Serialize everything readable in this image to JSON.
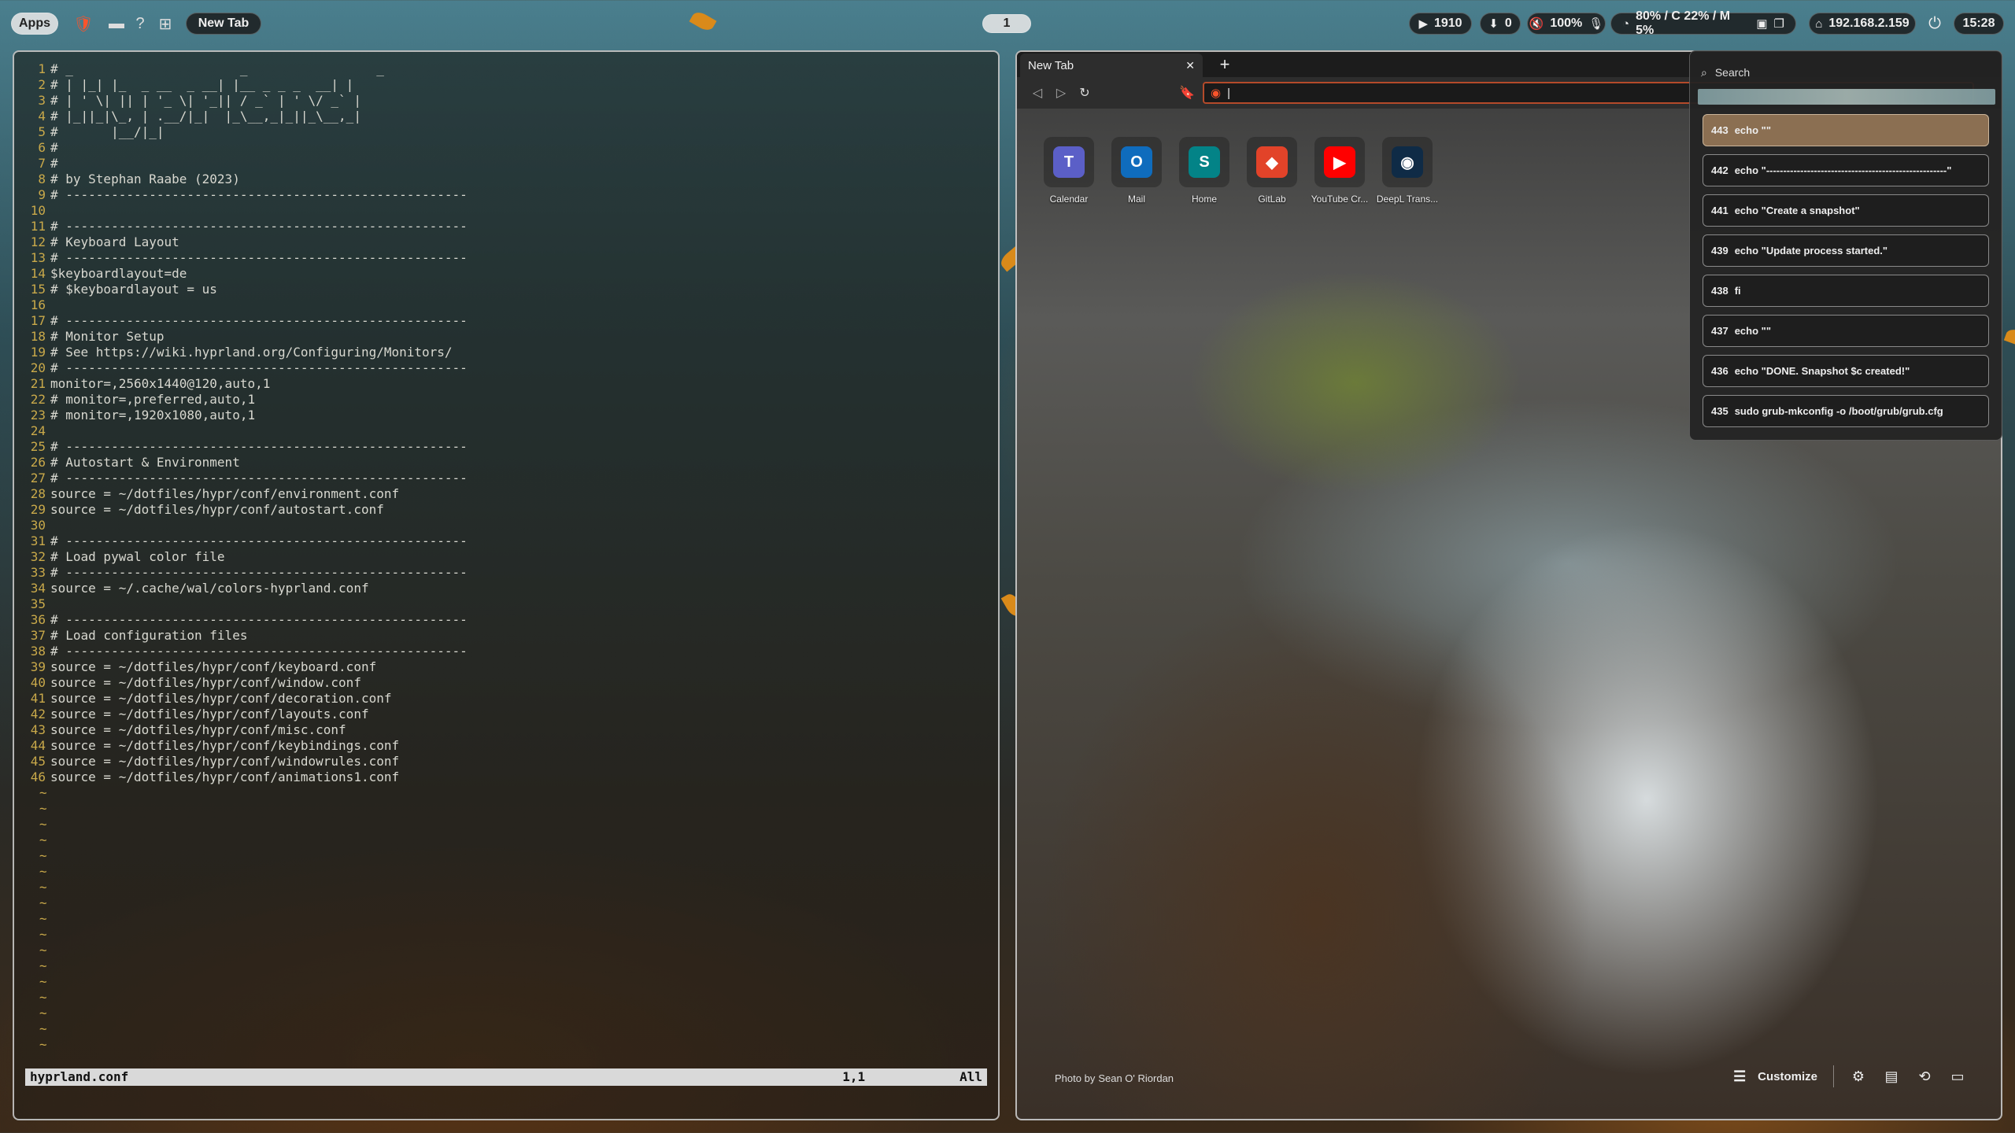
{
  "topbar": {
    "apps_label": "Apps",
    "active_window_label": "New Tab",
    "workspace": "1",
    "youtube_count": "1910",
    "updates_count": "0",
    "volume": "100%",
    "system_stats": "80% / C 22% / M 5%",
    "ip": "192.168.2.159",
    "clock": "15:28"
  },
  "editor": {
    "lines": [
      {
        "n": "1",
        "t": "# _                      _                 _ "
      },
      {
        "n": "2",
        "t": "# | |_| |_  _ __  _ __| |__ _ _ _  __| |"
      },
      {
        "n": "3",
        "t": "# | ' \\| || | '_ \\| '_|| / _` | ' \\/ _` |"
      },
      {
        "n": "4",
        "t": "# |_||_|\\_, | .__/|_|  |_\\__,_|_||_\\__,_|"
      },
      {
        "n": "5",
        "t": "#       |__/|_|                            "
      },
      {
        "n": "6",
        "t": "# "
      },
      {
        "n": "7",
        "t": "#"
      },
      {
        "n": "8",
        "t": "# by Stephan Raabe (2023)"
      },
      {
        "n": "9",
        "t": "# -----------------------------------------------------"
      },
      {
        "n": "10",
        "t": ""
      },
      {
        "n": "11",
        "t": "# -----------------------------------------------------"
      },
      {
        "n": "12",
        "t": "# Keyboard Layout"
      },
      {
        "n": "13",
        "t": "# -----------------------------------------------------"
      },
      {
        "n": "14",
        "t": "$keyboardlayout=de"
      },
      {
        "n": "15",
        "t": "# $keyboardlayout = us"
      },
      {
        "n": "16",
        "t": ""
      },
      {
        "n": "17",
        "t": "# -----------------------------------------------------"
      },
      {
        "n": "18",
        "t": "# Monitor Setup"
      },
      {
        "n": "19",
        "t": "# See https://wiki.hyprland.org/Configuring/Monitors/"
      },
      {
        "n": "20",
        "t": "# -----------------------------------------------------"
      },
      {
        "n": "21",
        "t": "monitor=,2560x1440@120,auto,1"
      },
      {
        "n": "22",
        "t": "# monitor=,preferred,auto,1"
      },
      {
        "n": "23",
        "t": "# monitor=,1920x1080,auto,1"
      },
      {
        "n": "24",
        "t": ""
      },
      {
        "n": "25",
        "t": "# -----------------------------------------------------"
      },
      {
        "n": "26",
        "t": "# Autostart & Environment"
      },
      {
        "n": "27",
        "t": "# -----------------------------------------------------"
      },
      {
        "n": "28",
        "t": "source = ~/dotfiles/hypr/conf/environment.conf"
      },
      {
        "n": "29",
        "t": "source = ~/dotfiles/hypr/conf/autostart.conf"
      },
      {
        "n": "30",
        "t": ""
      },
      {
        "n": "31",
        "t": "# -----------------------------------------------------"
      },
      {
        "n": "32",
        "t": "# Load pywal color file"
      },
      {
        "n": "33",
        "t": "# -----------------------------------------------------"
      },
      {
        "n": "34",
        "t": "source = ~/.cache/wal/colors-hyprland.conf"
      },
      {
        "n": "35",
        "t": ""
      },
      {
        "n": "36",
        "t": "# -----------------------------------------------------"
      },
      {
        "n": "37",
        "t": "# Load configuration files"
      },
      {
        "n": "38",
        "t": "# -----------------------------------------------------"
      },
      {
        "n": "39",
        "t": "source = ~/dotfiles/hypr/conf/keyboard.conf"
      },
      {
        "n": "40",
        "t": "source = ~/dotfiles/hypr/conf/window.conf"
      },
      {
        "n": "41",
        "t": "source = ~/dotfiles/hypr/conf/decoration.conf"
      },
      {
        "n": "42",
        "t": "source = ~/dotfiles/hypr/conf/layouts.conf"
      },
      {
        "n": "43",
        "t": "source = ~/dotfiles/hypr/conf/misc.conf"
      },
      {
        "n": "44",
        "t": "source = ~/dotfiles/hypr/conf/keybindings.conf"
      },
      {
        "n": "45",
        "t": "source = ~/dotfiles/hypr/conf/windowrules.conf"
      },
      {
        "n": "46",
        "t": "source = ~/dotfiles/hypr/conf/animations1.conf"
      }
    ],
    "tilde": "~",
    "filename": "hyprland.conf",
    "position": "1,1",
    "scroll": "All"
  },
  "browser": {
    "tab_title": "New Tab",
    "shortcuts": [
      {
        "label": "Calendar",
        "glyph": "T",
        "color": "#5b5fc7"
      },
      {
        "label": "Mail",
        "glyph": "O",
        "color": "#0f6cbd"
      },
      {
        "label": "Home",
        "glyph": "S",
        "color": "#038387"
      },
      {
        "label": "GitLab",
        "glyph": "◆",
        "color": "#e24329"
      },
      {
        "label": "YouTube Cr...",
        "glyph": "▶",
        "color": "#ff0000"
      },
      {
        "label": "DeepL Trans...",
        "glyph": "◉",
        "color": "#0f2b46"
      }
    ],
    "photo_credit_prefix": "Photo by",
    "photo_credit_author": "Sean O' Riordan",
    "customize_label": "Customize"
  },
  "history": {
    "search_placeholder": "Search",
    "items": [
      {
        "num": "443",
        "cmd": "echo \"\""
      },
      {
        "num": "442",
        "cmd": "echo \"-----------------------------------------------------\""
      },
      {
        "num": "441",
        "cmd": "echo \"Create a snapshot\""
      },
      {
        "num": "439",
        "cmd": "echo \"Update process started.\""
      },
      {
        "num": "438",
        "cmd": "fi"
      },
      {
        "num": "437",
        "cmd": "echo \"\""
      },
      {
        "num": "436",
        "cmd": "echo \"DONE. Snapshot $c created!\""
      },
      {
        "num": "435",
        "cmd": "sudo grub-mkconfig -o /boot/grub/grub.cfg"
      }
    ]
  },
  "colors": {
    "accent": "#8b6f52",
    "line_number": "#c9a94a"
  }
}
